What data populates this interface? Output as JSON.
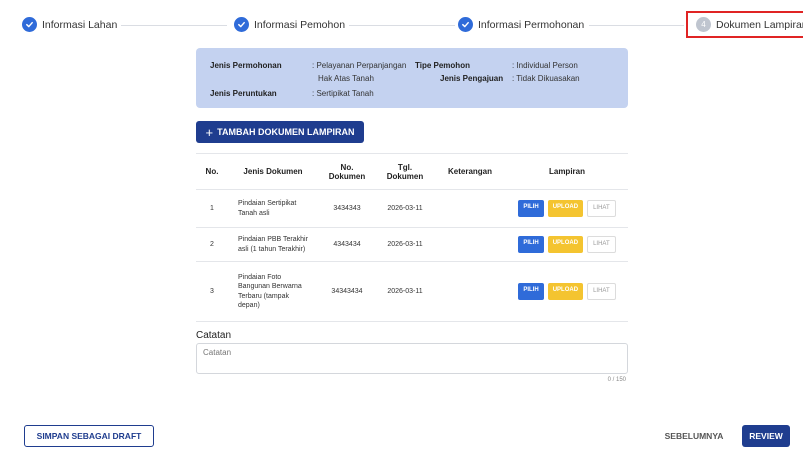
{
  "stepper": {
    "steps": [
      {
        "label": "Informasi Lahan",
        "status": "done"
      },
      {
        "label": "Informasi Pemohon",
        "status": "done"
      },
      {
        "label": "Informasi Permohonan",
        "status": "done"
      },
      {
        "label": "Dokumen Lampiran",
        "status": "active",
        "number": "4"
      }
    ]
  },
  "info": {
    "jenis_permohonan_label": "Jenis Permohonan",
    "jenis_permohonan_value_1": ": Pelayanan Perpanjangan",
    "jenis_permohonan_value_2": "Hak Atas Tanah",
    "tipe_pemohon_label": "Tipe Pemohon",
    "tipe_pemohon_value": ": Individual Person",
    "jenis_pengajuan_label": "Jenis Pengajuan",
    "jenis_pengajuan_value": ": Tidak Dikuasakan",
    "jenis_peruntukan_label": "Jenis Peruntukan",
    "jenis_peruntukan_value": ": Sertipikat Tanah"
  },
  "add_button": {
    "plus": "+",
    "label": "TAMBAH DOKUMEN LAMPIRAN"
  },
  "table": {
    "headers": {
      "no": "No.",
      "jenis": "Jenis Dokumen",
      "no_dokumen_1": "No.",
      "no_dokumen_2": "Dokumen",
      "tgl_1": "Tgl.",
      "tgl_2": "Dokumen",
      "keterangan": "Keterangan",
      "lampiran": "Lampiran"
    },
    "rows": [
      {
        "no": "1",
        "jenis_lines": [
          "Pindaian Sertipikat",
          "Tanah asli"
        ],
        "no_dokumen": "3434343",
        "tgl": "2026-03-11",
        "keterangan": ""
      },
      {
        "no": "2",
        "jenis_lines": [
          "Pindaian PBB Terakhir",
          "asli (1 tahun Terakhir)"
        ],
        "no_dokumen": "4343434",
        "tgl": "2026-03-11",
        "keterangan": ""
      },
      {
        "no": "3",
        "jenis_lines": [
          "Pindaian Foto",
          "Bangunan Berwarna",
          "Terbaru (tampak",
          "depan)"
        ],
        "no_dokumen": "34343434",
        "tgl": "2026-03-11",
        "keterangan": ""
      }
    ],
    "actions": {
      "pilih": "PILIH",
      "upload": "UPLOAD",
      "lihat": "LIHAT"
    }
  },
  "catatan": {
    "label": "Catatan",
    "placeholder": "Catatan",
    "value": "",
    "counter": "0 / 150"
  },
  "footer": {
    "draft": "SIMPAN SEBAGAI DRAFT",
    "prev": "SEBELUMNYA",
    "review": "REVIEW"
  },
  "colors": {
    "primary": "#1f3d8f",
    "accent_blue": "#2f6bd9",
    "info_bg": "#c4d2f0",
    "upload_yellow": "#f4c430",
    "active_border": "#e02424"
  },
  "icons": {
    "done": "check-circle-icon",
    "active": "numbered-circle-icon"
  }
}
